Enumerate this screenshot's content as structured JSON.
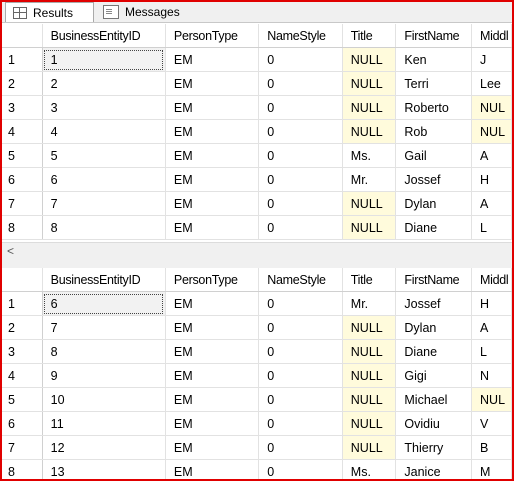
{
  "tabs": {
    "results": "Results",
    "messages": "Messages"
  },
  "columns": [
    "BusinessEntityID",
    "PersonType",
    "NameStyle",
    "Title",
    "FirstName",
    "Middl"
  ],
  "grid1": [
    [
      "1",
      "1",
      "EM",
      "0",
      "NULL",
      "Ken",
      "J"
    ],
    [
      "2",
      "2",
      "EM",
      "0",
      "NULL",
      "Terri",
      "Lee"
    ],
    [
      "3",
      "3",
      "EM",
      "0",
      "NULL",
      "Roberto",
      "NUL"
    ],
    [
      "4",
      "4",
      "EM",
      "0",
      "NULL",
      "Rob",
      "NUL"
    ],
    [
      "5",
      "5",
      "EM",
      "0",
      "Ms.",
      "Gail",
      "A"
    ],
    [
      "6",
      "6",
      "EM",
      "0",
      "Mr.",
      "Jossef",
      "H"
    ],
    [
      "7",
      "7",
      "EM",
      "0",
      "NULL",
      "Dylan",
      "A"
    ],
    [
      "8",
      "8",
      "EM",
      "0",
      "NULL",
      "Diane",
      "L"
    ]
  ],
  "grid2": [
    [
      "1",
      "6",
      "EM",
      "0",
      "Mr.",
      "Jossef",
      "H"
    ],
    [
      "2",
      "7",
      "EM",
      "0",
      "NULL",
      "Dylan",
      "A"
    ],
    [
      "3",
      "8",
      "EM",
      "0",
      "NULL",
      "Diane",
      "L"
    ],
    [
      "4",
      "9",
      "EM",
      "0",
      "NULL",
      "Gigi",
      "N"
    ],
    [
      "5",
      "10",
      "EM",
      "0",
      "NULL",
      "Michael",
      "NUL"
    ],
    [
      "6",
      "11",
      "EM",
      "0",
      "NULL",
      "Ovidiu",
      "V"
    ],
    [
      "7",
      "12",
      "EM",
      "0",
      "NULL",
      "Thierry",
      "B"
    ],
    [
      "8",
      "13",
      "EM",
      "0",
      "Ms.",
      "Janice",
      "M"
    ]
  ],
  "scroll_left_arrow": "<",
  "colors": {
    "border_highlight": "#e00000",
    "null_cell": "#fffbdc"
  },
  "icons": {
    "results": "grid-icon",
    "messages": "messages-icon",
    "scroll": "scroll-left-arrow-icon"
  }
}
